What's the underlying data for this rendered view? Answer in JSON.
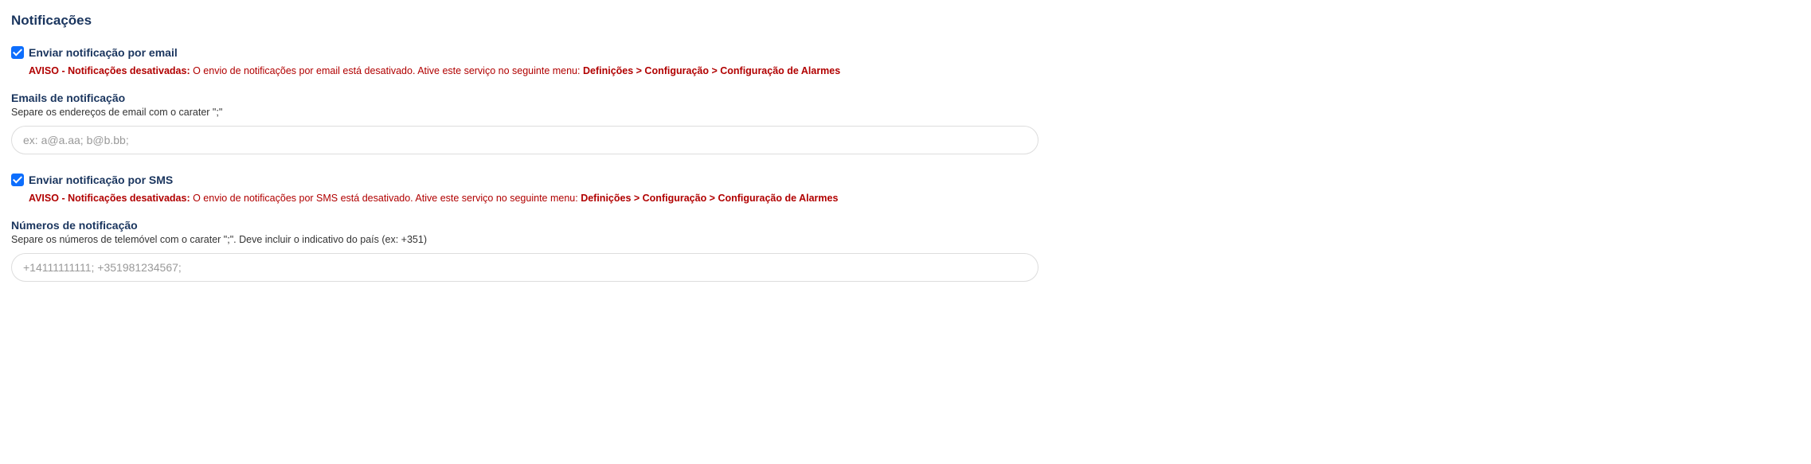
{
  "section": {
    "title": "Notificações"
  },
  "email": {
    "checkbox_label": "Enviar notificação por email",
    "checked": true,
    "warning_prefix": "AVISO - Notificações desativadas:",
    "warning_text": " O envio de notificações por email está desativado. Ative este serviço no seguinte menu: ",
    "warning_path": "Definições > Configuração > Configuração de Alarmes",
    "field_label": "Emails de notificação",
    "field_help": "Separe os endereços de email com o carater \";\"",
    "placeholder": "ex: a@a.aa; b@b.bb;",
    "value": ""
  },
  "sms": {
    "checkbox_label": "Enviar notificação por SMS",
    "checked": true,
    "warning_prefix": "AVISO - Notificações desativadas:",
    "warning_text": " O envio de notificações por SMS está desativado. Ative este serviço no seguinte menu: ",
    "warning_path": "Definições > Configuração > Configuração de Alarmes",
    "field_label": "Números de notificação",
    "field_help": "Separe os números de telemóvel com o carater \";\". Deve incluir o indicativo do país (ex: +351)",
    "placeholder": "+14111111111; +351981234567;",
    "value": ""
  }
}
